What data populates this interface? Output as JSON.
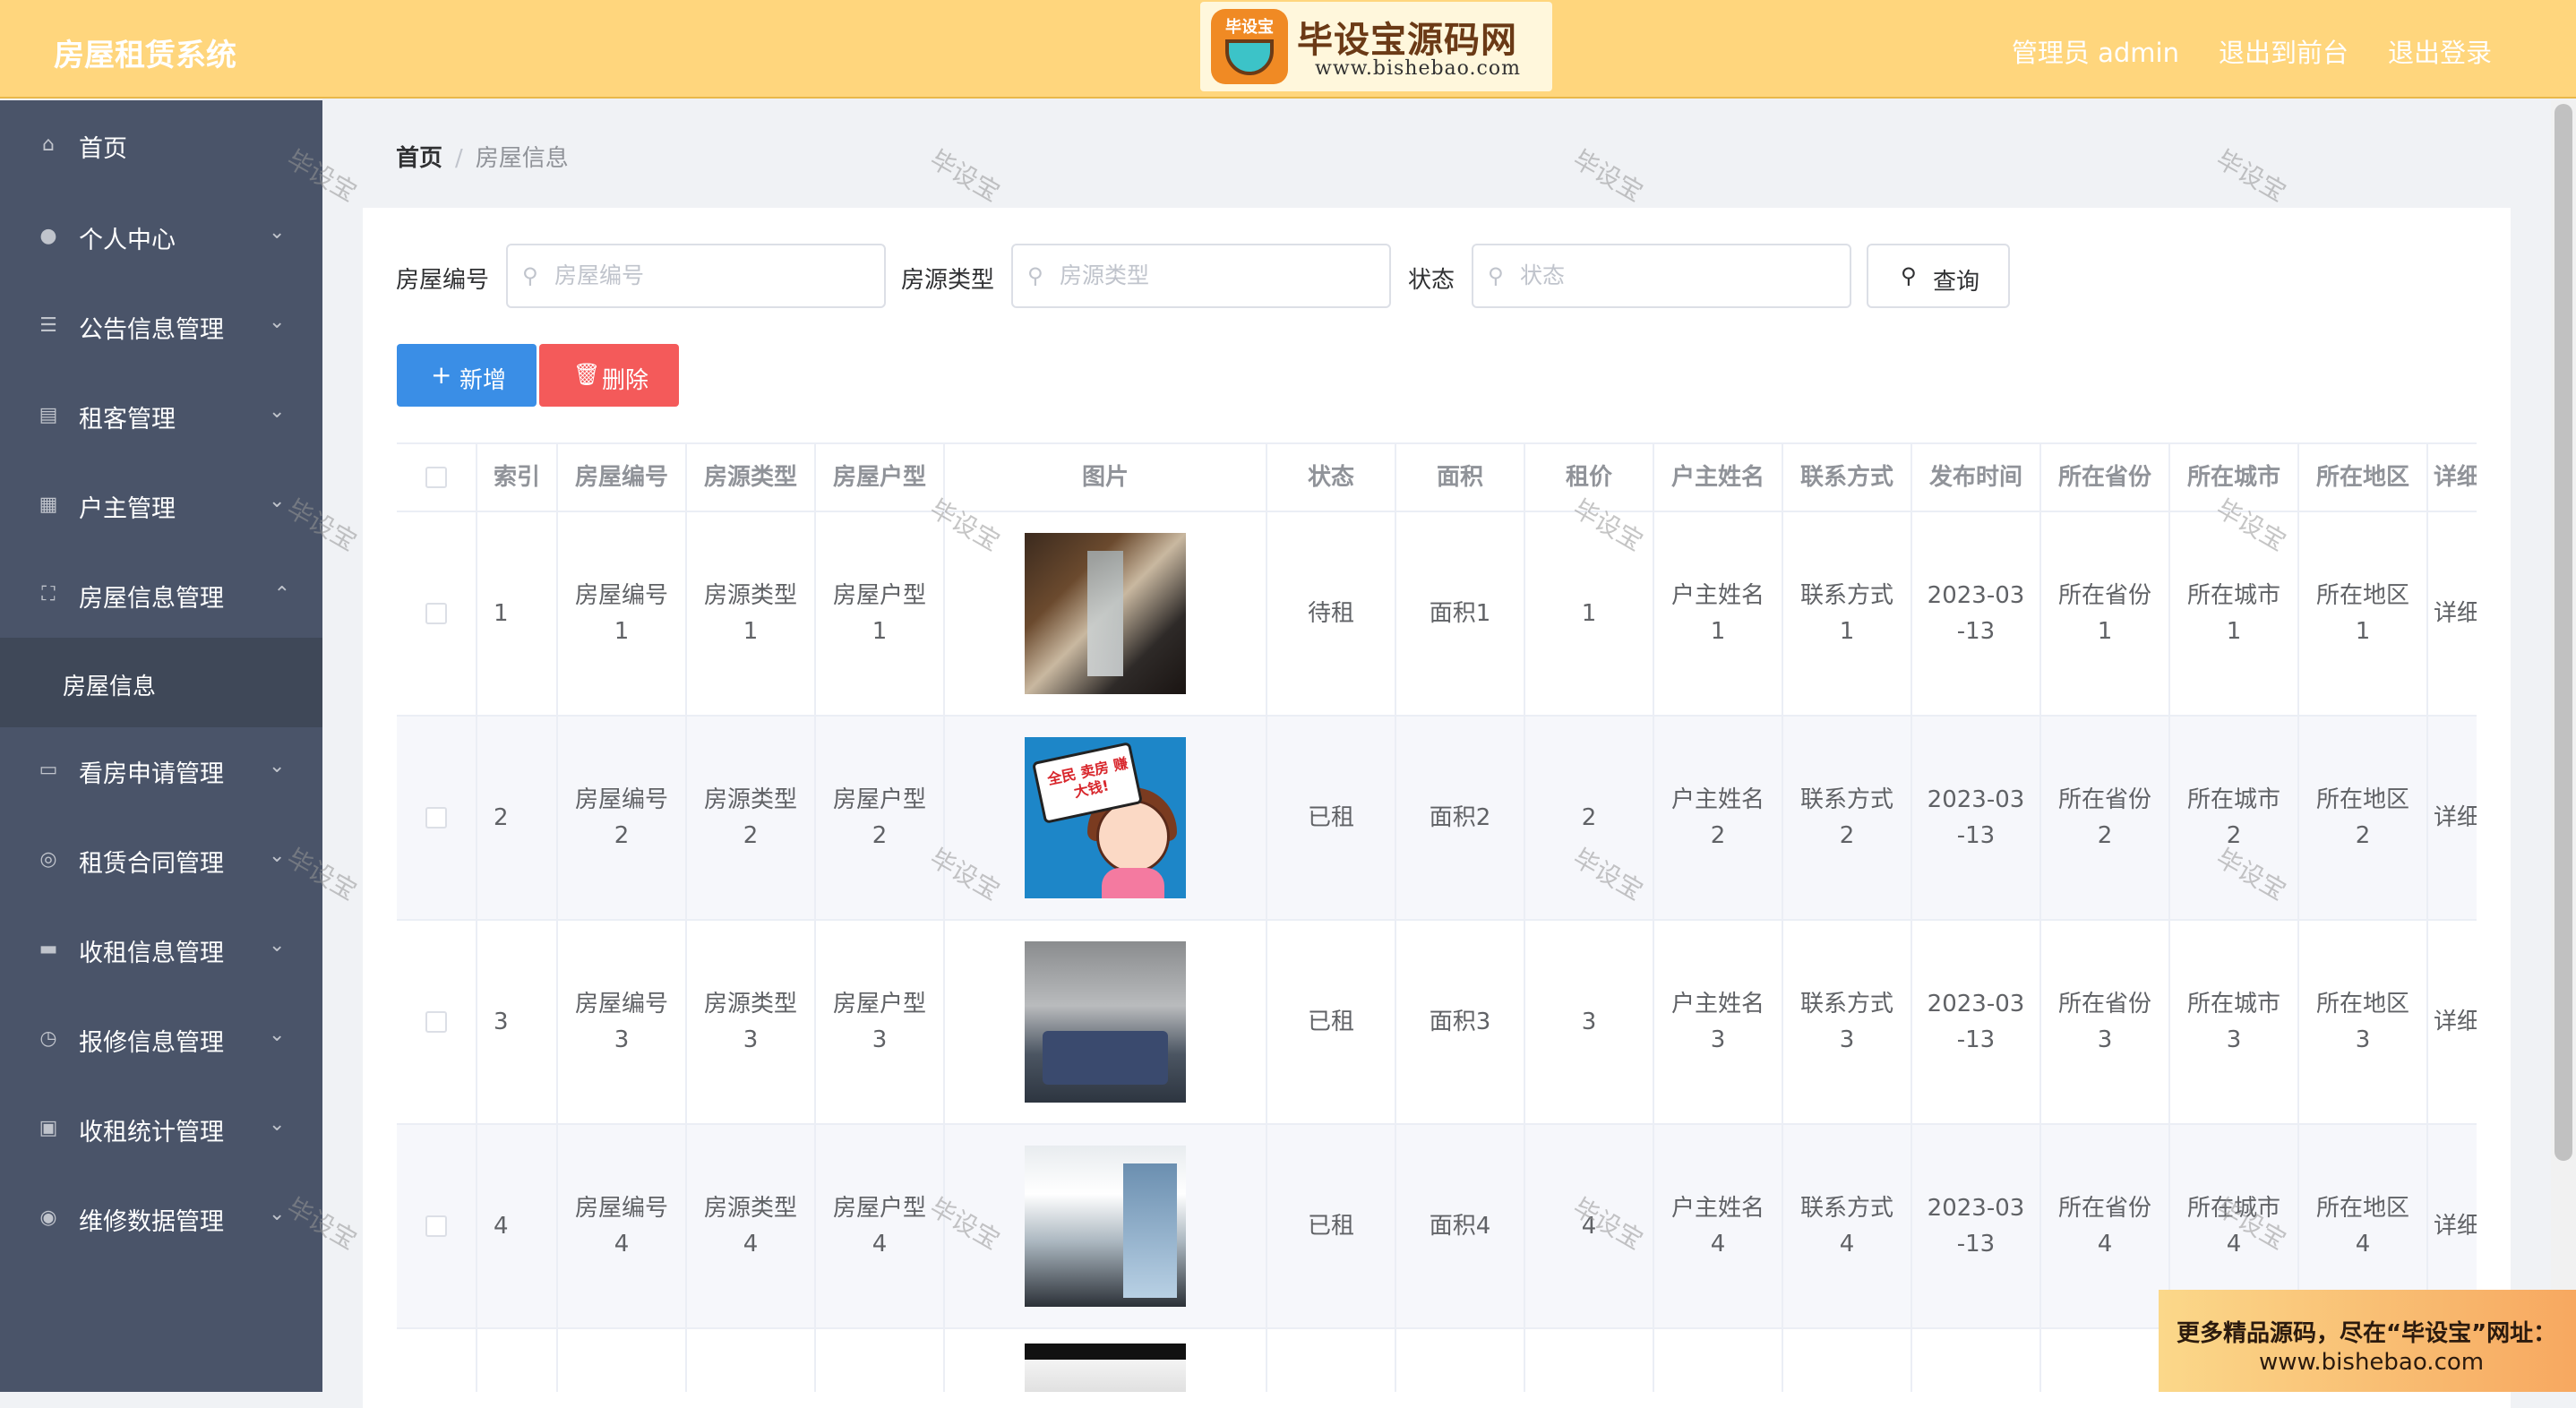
{
  "header": {
    "title": "房屋租赁系统",
    "logo": {
      "badge": "毕设宝",
      "name": "毕设宝源码网",
      "url": "www.bishebao.com"
    },
    "links": [
      "管理员 admin",
      "退出到前台",
      "退出登录"
    ]
  },
  "sidebar": {
    "items": [
      {
        "label": "首页",
        "icon": "home-icon"
      },
      {
        "label": "个人中心",
        "icon": "user-icon"
      },
      {
        "label": "公告信息管理",
        "icon": "sliders-icon"
      },
      {
        "label": "租客管理",
        "icon": "id-card-icon"
      },
      {
        "label": "户主管理",
        "icon": "grid-icon"
      },
      {
        "label": "房屋信息管理",
        "icon": "fullscreen-icon"
      },
      {
        "label": "看房申请管理",
        "icon": "chat-icon"
      },
      {
        "label": "租赁合同管理",
        "icon": "target-icon"
      },
      {
        "label": "收租信息管理",
        "icon": "message-icon"
      },
      {
        "label": "报修信息管理",
        "icon": "clock-icon"
      },
      {
        "label": "收租统计管理",
        "icon": "ticket-icon"
      },
      {
        "label": "维修数据管理",
        "icon": "circle-icon"
      }
    ],
    "active_sub": "房屋信息"
  },
  "breadcrumb": {
    "home": "首页",
    "separator": "/",
    "current": "房屋信息"
  },
  "search": {
    "fields": [
      {
        "label": "房屋编号",
        "placeholder": "房屋编号"
      },
      {
        "label": "房源类型",
        "placeholder": "房源类型"
      },
      {
        "label": "状态",
        "placeholder": "状态"
      }
    ],
    "query_label": "查询"
  },
  "actions": {
    "add_label": "新增",
    "delete_label": "删除"
  },
  "table": {
    "headers": [
      "索引",
      "房屋编号",
      "房源类型",
      "房屋户型",
      "图片",
      "状态",
      "面积",
      "租价",
      "户主姓名",
      "联系方式",
      "发布时间",
      "所在省份",
      "所在城市",
      "所在地区",
      "详细"
    ],
    "rows": [
      {
        "index": "1",
        "house_no": "房屋编号\n1",
        "source_type": "房源类型\n1",
        "layout": "房屋户型\n1",
        "status": "待租",
        "area": "面积1",
        "rent": "1",
        "owner": "户主姓名\n1",
        "contact": "联系方式\n1",
        "publish": "2023-03\n-13",
        "province": "所在省份\n1",
        "city": "所在城市\n1",
        "district": "所在地区\n1",
        "detail": "详细"
      },
      {
        "index": "2",
        "house_no": "房屋编号\n2",
        "source_type": "房源类型\n2",
        "layout": "房屋户型\n2",
        "status": "已租",
        "area": "面积2",
        "rent": "2",
        "owner": "户主姓名\n2",
        "contact": "联系方式\n2",
        "publish": "2023-03\n-13",
        "province": "所在省份\n2",
        "city": "所在城市\n2",
        "district": "所在地区\n2",
        "detail": "详细"
      },
      {
        "index": "3",
        "house_no": "房屋编号\n3",
        "source_type": "房源类型\n3",
        "layout": "房屋户型\n3",
        "status": "已租",
        "area": "面积3",
        "rent": "3",
        "owner": "户主姓名\n3",
        "contact": "联系方式\n3",
        "publish": "2023-03\n-13",
        "province": "所在省份\n3",
        "city": "所在城市\n3",
        "district": "所在地区\n3",
        "detail": "详细"
      },
      {
        "index": "4",
        "house_no": "房屋编号\n4",
        "source_type": "房源类型\n4",
        "layout": "房屋户型\n4",
        "status": "已租",
        "area": "面积4",
        "rent": "4",
        "owner": "户主姓名\n4",
        "contact": "联系方式\n4",
        "publish": "2023-03\n-13",
        "province": "所在省份\n4",
        "city": "所在城市\n4",
        "district": "所在地区\n4",
        "detail": "详细"
      }
    ],
    "image2_caption": "全民 卖房 赚大钱!"
  },
  "watermark": "毕设宝",
  "promo": {
    "line1": "更多精品源码，尽在“毕设宝”网址：",
    "line2": "www.bishebao.com"
  },
  "colors": {
    "header_bg": "#ffd67d",
    "sidebar_bg": "#4a5469",
    "add_button": "#3a8ee6",
    "delete_button": "#f45a5a"
  }
}
